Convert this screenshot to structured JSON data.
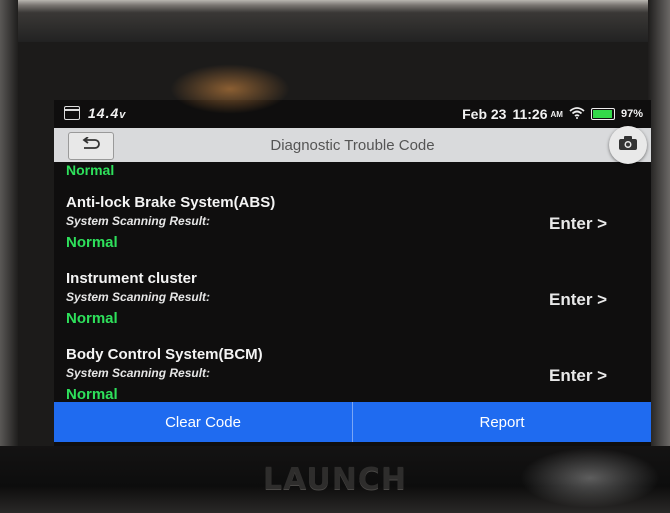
{
  "device": {
    "brand": "LAUNCH"
  },
  "status_bar": {
    "voltage": "14.4",
    "voltage_unit": "v",
    "date": "Feb 23",
    "time": "11:26",
    "ampm": "AM",
    "battery_percent": "97%",
    "battery_level": 0.97,
    "icons": [
      "calendar-icon",
      "wifi-icon",
      "battery-icon"
    ]
  },
  "title_bar": {
    "title": "Diagnostic Trouble Code",
    "back_icon": "back-arrow-icon",
    "camera_icon": "camera-icon"
  },
  "list": {
    "partial_status": "Normal",
    "items": [
      {
        "name": "Anti-lock Brake System(ABS)",
        "label": "System Scanning Result:",
        "status": "Normal",
        "action": "Enter >"
      },
      {
        "name": "Instrument cluster",
        "label": "System Scanning Result:",
        "status": "Normal",
        "action": "Enter >"
      },
      {
        "name": "Body Control System(BCM)",
        "label": "System Scanning Result:",
        "status": "Normal",
        "action": "Enter >"
      }
    ]
  },
  "actions": {
    "clear_code": "Clear Code",
    "report": "Report"
  },
  "colors": {
    "status_ok": "#2ee05b",
    "action_bar": "#1f6bf0",
    "title_bar": "#d9dadc"
  }
}
